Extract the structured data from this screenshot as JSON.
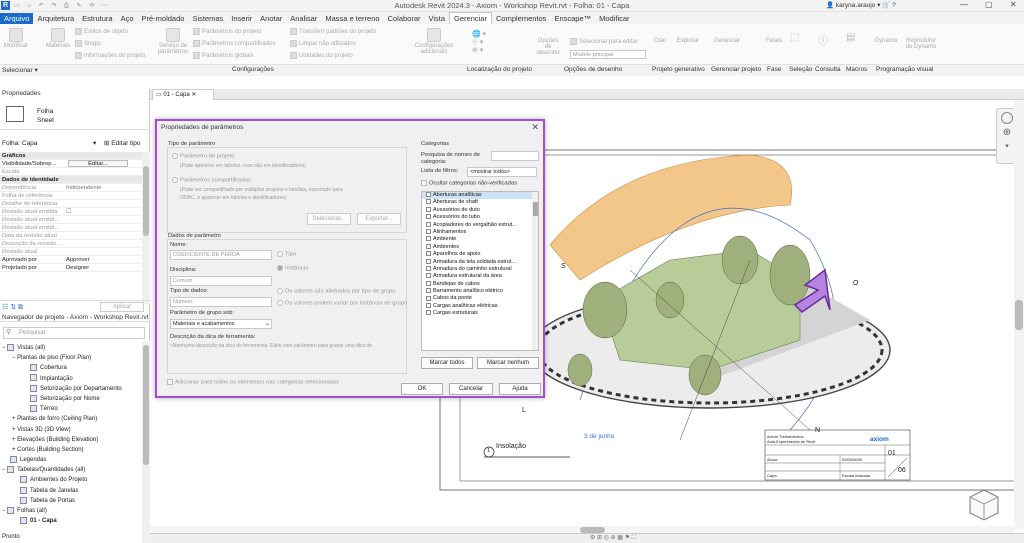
{
  "app": {
    "title": "Autodesk Revit 2024.3 - Axiom - Workshop Revit.rvt - Folha: 01 - Capa",
    "user": "karyna.araujo",
    "help": "?"
  },
  "menu": [
    "Arquivo",
    "Arquitetura",
    "Estrutura",
    "Aço",
    "Pré-moldado",
    "Sistemas",
    "Inserir",
    "Anotar",
    "Analisar",
    "Massa e terreno",
    "Colaborar",
    "Vista",
    "Gerenciar",
    "Complementos",
    "Enscape™",
    "Modificar"
  ],
  "ribbon": {
    "buttons": {
      "modificar": "Modificar",
      "materiais": "Materiais",
      "servico": "Serviço de parâmetros",
      "config": "Configurações adicionais",
      "opcoes": "Opções de desenho",
      "criar": "Criar",
      "explorar": "Explorar",
      "gerenciar": "Gerenciar",
      "fases": "Fases",
      "dynamo": "Dynamo",
      "reprodutor": "Reprodutor do Dynamo"
    },
    "small": [
      "Estilos de objeto",
      "Snaps",
      "Informações do projeto",
      "Parâmetros do projeto",
      "Parâmetros compartilhados",
      "Parâmetros globais",
      "Transferir padrões do projeto",
      "Limpar não utilizados",
      "Unidades do projeto",
      "Selecionar para editar",
      "Modelo principal"
    ],
    "panels": [
      "Selecionar ▾",
      "Configurações",
      "Localização do projeto",
      "Opções de desenho",
      "Projeto generativo",
      "Gerenciar projeto",
      "Fase",
      "Seleção",
      "Consulta",
      "Macros",
      "Programação visual"
    ]
  },
  "properties": {
    "title": "Propriedades",
    "type_name": "Folha",
    "type_sub": "Sheet",
    "selector": "Folha: Capa",
    "edit_type": "Editar tipo",
    "rows": [
      {
        "k": "Gráficos",
        "v": "",
        "sec": true
      },
      {
        "k": "Visibilidade/Sobrep...",
        "v": "Editar...",
        "btn": true
      },
      {
        "k": "Escala",
        "v": ""
      },
      {
        "k": "Dados de identidade",
        "v": "",
        "sec": true
      },
      {
        "k": "Dependência",
        "v": "Independente"
      },
      {
        "k": "Folha de referência",
        "v": ""
      },
      {
        "k": "Detalhe de referência",
        "v": ""
      },
      {
        "k": "Revisão atual emitida",
        "v": "☐"
      },
      {
        "k": "Revisão atual emitid...",
        "v": ""
      },
      {
        "k": "Revisão atual emitid...",
        "v": ""
      },
      {
        "k": "Data da revisão atual",
        "v": ""
      },
      {
        "k": "Descrição da revisão...",
        "v": ""
      },
      {
        "k": "Revisão atual",
        "v": ""
      },
      {
        "k": "Aprovado por",
        "v": "Approver"
      },
      {
        "k": "Projetado por",
        "v": "Designer"
      }
    ],
    "apply": "Aplicar"
  },
  "browser": {
    "title": "Navegador de projeto - Axiom - Workshop Revit.rvt",
    "search_placeholder": "Pesquisar",
    "items": [
      {
        "t": "Vistas (all)",
        "lvl": 0,
        "exp": "−"
      },
      {
        "t": "Plantas de piso (Floor Plan)",
        "lvl": 1,
        "exp": "−"
      },
      {
        "t": "Cobertura",
        "lvl": 2
      },
      {
        "t": "Implantação",
        "lvl": 2
      },
      {
        "t": "Setorização por Departamento",
        "lvl": 2
      },
      {
        "t": "Setorização por Nome",
        "lvl": 2
      },
      {
        "t": "Térreo",
        "lvl": 2
      },
      {
        "t": "Plantas de forro (Ceiling Plan)",
        "lvl": 1,
        "exp": "+"
      },
      {
        "t": "Vistas 3D (3D View)",
        "lvl": 1,
        "exp": "+"
      },
      {
        "t": "Elevações (Building Elevation)",
        "lvl": 1,
        "exp": "+"
      },
      {
        "t": "Cortes (Building Section)",
        "lvl": 1,
        "exp": "+"
      },
      {
        "t": "Legendas",
        "lvl": 0
      },
      {
        "t": "Tabelas/Quantidades (all)",
        "lvl": 0,
        "exp": "−"
      },
      {
        "t": "Ambientes do Projeto",
        "lvl": 1
      },
      {
        "t": "Tabela de Janelas",
        "lvl": 1
      },
      {
        "t": "Tabela de Portas",
        "lvl": 1
      },
      {
        "t": "Folhas (all)",
        "lvl": 0,
        "exp": "−"
      },
      {
        "t": "01 - Capa",
        "lvl": 1,
        "sel": true
      }
    ]
  },
  "doc_tab": "01 - Capa",
  "status": "Pronto",
  "dialog": {
    "title": "Propriedades de parâmetros",
    "tipo_label": "Tipo de parâmetro",
    "proj_label": "Parâmetro de projeto",
    "proj_desc": "(Pode aparecer em tabelas, mas não em identificadores)",
    "comp_label": "Parâmetros compartilhados",
    "comp_desc1": "(Pode ser compartilhado por múltiplos projetos e famílias, exportado para",
    "comp_desc2": "ODBC, e aparecer em tabelas e identificadores)",
    "selecionar": "Selecionar...",
    "exportar": "Exportar...",
    "dados_label": "Dados de parâmetro",
    "nome_label": "Nome:",
    "nome_value": "COEFICIENTE DE PERDA",
    "tipo_radio": "Tipo",
    "instancia_radio": "Instância",
    "disciplina_label": "Disciplina:",
    "disciplina_value": "Comum",
    "tipo_dados_label": "Tipo de dados:",
    "tipo_dados_value": "Número",
    "alinhados": "Os valores são alinhados por tipo de grupo",
    "variar": "Os valores podem variar por instância de grupo",
    "grupo_label": "Parâmetro de grupo sob:",
    "grupo_value": "Materiais e acabamentos",
    "dica_label": "Descrição da dica de ferramenta:",
    "dica_text": "<Nenhuma descrição da dica de ferramenta. Edite este parâmetro para gravar uma dica de",
    "adicionar": "Adicionar para todos os elementos nas categorias selecionadas",
    "categorias_label": "Categorias",
    "pesquisa_label": "Pesquisa de nomes de categoria:",
    "filtros_label": "Lista de filtros:",
    "filtros_value": "<mostrar todos>",
    "ocultar": "Ocultar categorias não-verificadas",
    "categories": [
      "Aberturas analíticas",
      "Aberturas de shaft",
      "Acessórios de duto",
      "Acessórios do tubo",
      "Acopladores do vergalhão estrut...",
      "Alinhamentos",
      "Ambiente",
      "Ambientes",
      "Aparelhos de apoio",
      "Armadura da tela soldada estrut...",
      "Armadura do caminho estrutural",
      "Armadura estrutural da área",
      "Bandejas de cabos",
      "Barramento analítico elétrico",
      "Cabos da ponte",
      "Cargas analíticas elétricas",
      "Cargas estruturais"
    ],
    "marcar_todos": "Marcar todos",
    "marcar_nenhum": "Marcar nenhum",
    "ok": "OK",
    "cancelar": "Cancelar",
    "ajuda": "Ajuda"
  },
  "drawing": {
    "labels": {
      "s": "S",
      "l": "L",
      "o": "O",
      "n": "N",
      "date": "3 de junho"
    },
    "view_number": "1",
    "view_title": "Insolação",
    "titleblock": {
      "company": "Axiom Treinamentos",
      "project": "Aula Experimental de Revit",
      "aluno": "Aluno:",
      "data": "00/00/0000",
      "capa": "Capa",
      "escala": "Escala indicada",
      "sheet_num": "01",
      "sheet_total": "06",
      "logo": "axiom"
    }
  }
}
